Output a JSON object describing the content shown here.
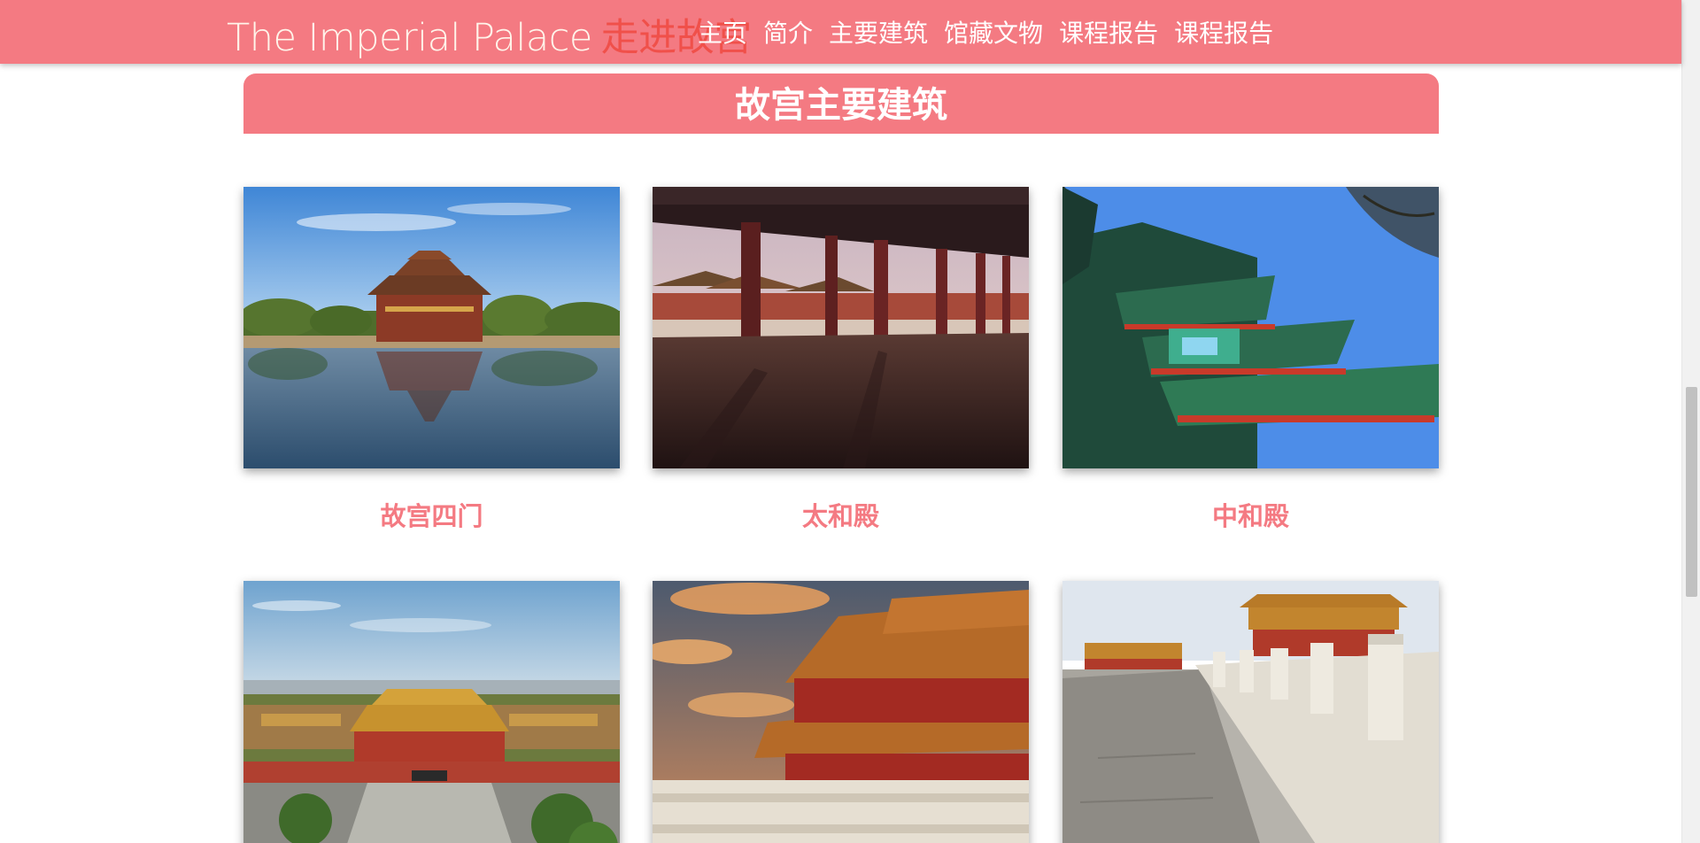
{
  "header": {
    "brand_en": "The Imperial Palace",
    "brand_cn": "走进故宫",
    "nav": [
      "主页",
      "简介",
      "主要建筑",
      "馆藏文物",
      "课程报告",
      "课程报告"
    ]
  },
  "section": {
    "title": "故宫主要建筑"
  },
  "cards": [
    {
      "title": "故宫四门",
      "image": "corner-tower-moat-photo"
    },
    {
      "title": "太和殿",
      "image": "hall-colonnade-photo"
    },
    {
      "title": "中和殿",
      "image": "eaves-blue-sky-photo"
    },
    {
      "title": "",
      "image": "palace-aerial-photo"
    },
    {
      "title": "",
      "image": "hall-sunset-photo"
    },
    {
      "title": "",
      "image": "marble-terrace-photo"
    }
  ],
  "colors": {
    "accent": "#f47a82",
    "brand_cn": "#f0504a"
  }
}
